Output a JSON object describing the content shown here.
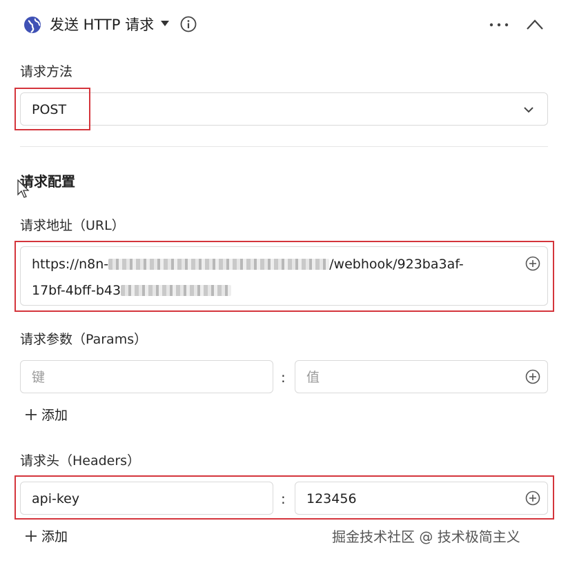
{
  "header": {
    "title": "发送 HTTP 请求",
    "icons": {
      "node": "globe-icon",
      "dropdown": "caret-down-icon",
      "info": "info-icon",
      "more": "more-dots-icon",
      "collapse": "chevron-up-icon"
    }
  },
  "method": {
    "label": "请求方法",
    "value": "POST"
  },
  "config": {
    "title": "请求配置"
  },
  "url": {
    "label": "请求地址（URL）",
    "line1_prefix": "https://n8n-",
    "line1_suffix": "/webhook/923ba3af-",
    "line2_prefix": "17bf-4bff-b43"
  },
  "params": {
    "label": "请求参数（Params）",
    "key_placeholder": "键",
    "value_placeholder": "值",
    "separator": ":",
    "add_label": "添加"
  },
  "headers": {
    "label": "请求头（Headers）",
    "key": "api-key",
    "value": "123456",
    "separator": ":",
    "add_label": "添加"
  },
  "watermark": "掘金技术社区 @ 技术极简主义",
  "colors": {
    "highlight": "#d4343b",
    "globe": "#3f51b5",
    "border": "#d9d9d9"
  }
}
